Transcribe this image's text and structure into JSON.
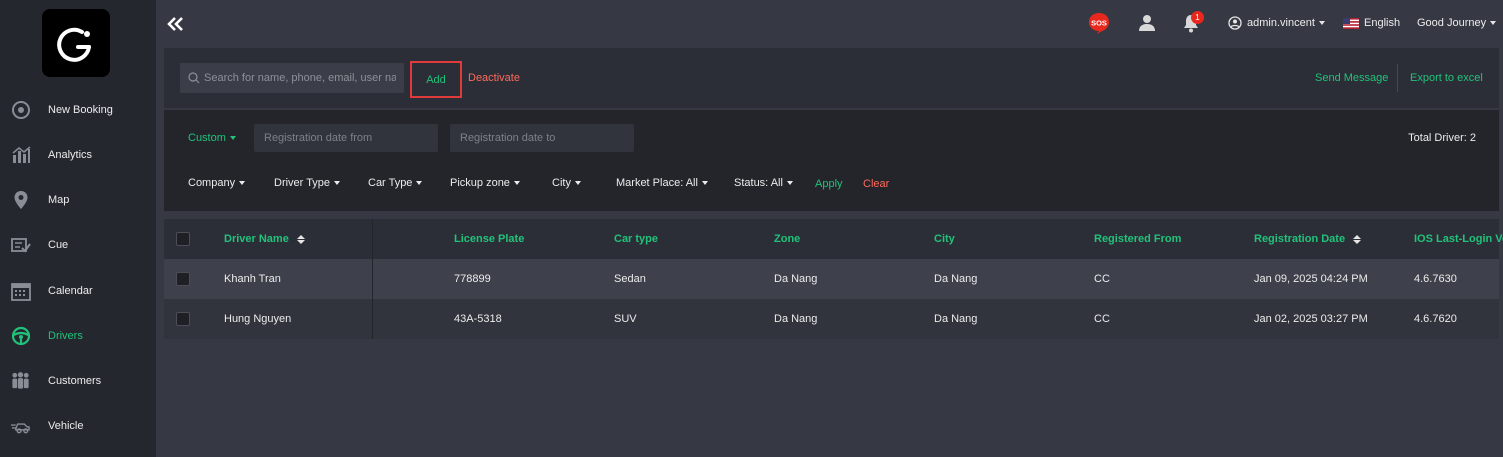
{
  "sidebar": {
    "items": [
      {
        "label": "New Booking",
        "icon": "plus-circle-icon"
      },
      {
        "label": "Analytics",
        "icon": "analytics-icon"
      },
      {
        "label": "Map",
        "icon": "map-pin-icon"
      },
      {
        "label": "Cue",
        "icon": "cue-icon"
      },
      {
        "label": "Calendar",
        "icon": "calendar-icon"
      },
      {
        "label": "Drivers",
        "icon": "steering-wheel-icon",
        "active": true
      },
      {
        "label": "Customers",
        "icon": "customers-icon"
      },
      {
        "label": "Vehicle",
        "icon": "vehicle-icon"
      }
    ]
  },
  "topbar": {
    "sos": "SOS",
    "notification_count": "1",
    "user": "admin.vincent",
    "language": "English",
    "company": "Good Journey"
  },
  "actions": {
    "search_placeholder": "Search for name, phone, email, user name",
    "add": "Add",
    "deactivate": "Deactivate",
    "send_message": "Send Message",
    "export": "Export to excel"
  },
  "filters": {
    "custom": "Custom",
    "date_from_placeholder": "Registration date from",
    "date_to_placeholder": "Registration date to",
    "total": "Total Driver: 2",
    "dropdowns": [
      "Company",
      "Driver Type",
      "Car Type",
      "Pickup zone",
      "City",
      "Market Place: All",
      "Status: All"
    ],
    "apply": "Apply",
    "clear": "Clear"
  },
  "table": {
    "headers": [
      "Driver Name",
      "License Plate",
      "Car type",
      "Zone",
      "City",
      "Registered From",
      "Registration Date",
      "IOS Last-Login Version"
    ],
    "rows": [
      [
        "Khanh Tran",
        "778899",
        "Sedan",
        "Da Nang",
        "Da Nang",
        "CC",
        "Jan 09, 2025 04:24 PM",
        "4.6.7630"
      ],
      [
        "Hung Nguyen",
        "43A-5318",
        "SUV",
        "Da Nang",
        "Da Nang",
        "CC",
        "Jan 02, 2025 03:27 PM",
        "4.6.7620"
      ]
    ]
  },
  "colors": {
    "accent": "#21c27a",
    "danger": "#ff6a5c",
    "highlight_border": "#e03a3a",
    "sidebar_bg": "#25272f",
    "page_bg": "#363944"
  }
}
